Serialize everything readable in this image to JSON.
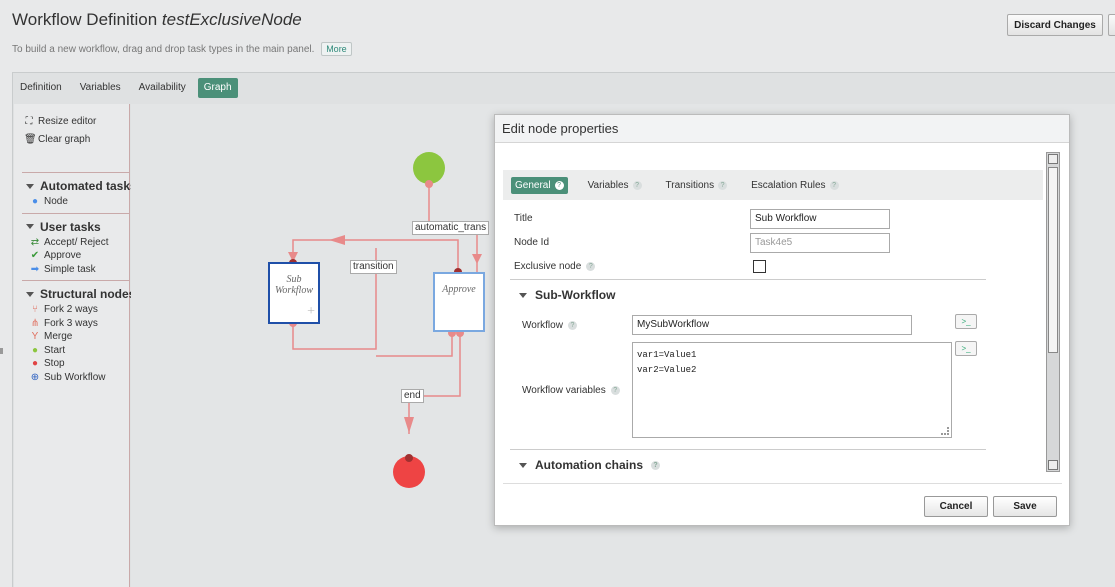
{
  "header": {
    "title_prefix": "Workflow Definition",
    "title_name": "testExclusiveNode",
    "subtitle": "To build a new workflow, drag and drop task types in the main panel.",
    "more_label": "More",
    "discard_label": "Discard Changes"
  },
  "tabs": [
    {
      "label": "Definition"
    },
    {
      "label": "Variables"
    },
    {
      "label": "Availability"
    },
    {
      "label": "Graph",
      "active": true
    }
  ],
  "sidebar": {
    "tools": [
      {
        "label": "Resize editor",
        "icon": "resize-icon"
      },
      {
        "label": "Clear graph",
        "icon": "trash-icon"
      }
    ],
    "sections": [
      {
        "title": "Automated tasks",
        "items": [
          {
            "label": "Node",
            "icon": "blue-dot-icon"
          }
        ]
      },
      {
        "title": "User tasks",
        "items": [
          {
            "label": "Accept/ Reject",
            "icon": "accept-reject-icon"
          },
          {
            "label": "Approve",
            "icon": "check-icon"
          },
          {
            "label": "Simple task",
            "icon": "arrow-right-icon"
          }
        ]
      },
      {
        "title": "Structural nodes",
        "items": [
          {
            "label": "Fork 2 ways",
            "icon": "fork-2-icon"
          },
          {
            "label": "Fork 3 ways",
            "icon": "fork-3-icon"
          },
          {
            "label": "Merge",
            "icon": "merge-icon"
          },
          {
            "label": "Start",
            "icon": "green-dot-icon"
          },
          {
            "label": "Stop",
            "icon": "red-dot-icon"
          },
          {
            "label": "Sub Workflow",
            "icon": "sub-workflow-icon"
          }
        ]
      }
    ]
  },
  "graph": {
    "labels": {
      "automatic": "automatic_trans",
      "transition": "transition",
      "end": "end"
    },
    "nodes": {
      "sub_workflow": "Sub Workflow",
      "approve": "Approve"
    }
  },
  "dialog": {
    "title": "Edit node properties",
    "tabs": [
      {
        "label": "General",
        "active": true
      },
      {
        "label": "Variables"
      },
      {
        "label": "Transitions"
      },
      {
        "label": "Escalation Rules"
      }
    ],
    "fields": {
      "title_label": "Title",
      "title_value": "Sub Workflow",
      "node_id_label": "Node Id",
      "node_id_placeholder": "Task4e5",
      "exclusive_label": "Exclusive node",
      "exclusive_checked": false
    },
    "sub_workflow": {
      "heading": "Sub-Workflow",
      "workflow_label": "Workflow",
      "workflow_value": "MySubWorkflow",
      "variables_label": "Workflow variables",
      "variables_value": "var1=Value1\nvar2=Value2"
    },
    "automation": {
      "heading": "Automation chains"
    },
    "cancel_label": "Cancel",
    "save_label": "Save"
  },
  "colors": {
    "accent": "#4b9079",
    "edge": "#e88a8a",
    "start": "#8cc63f",
    "stop": "#ee4444",
    "sub_border": "#1f4fa8",
    "approve_border": "#7aa8e0"
  }
}
